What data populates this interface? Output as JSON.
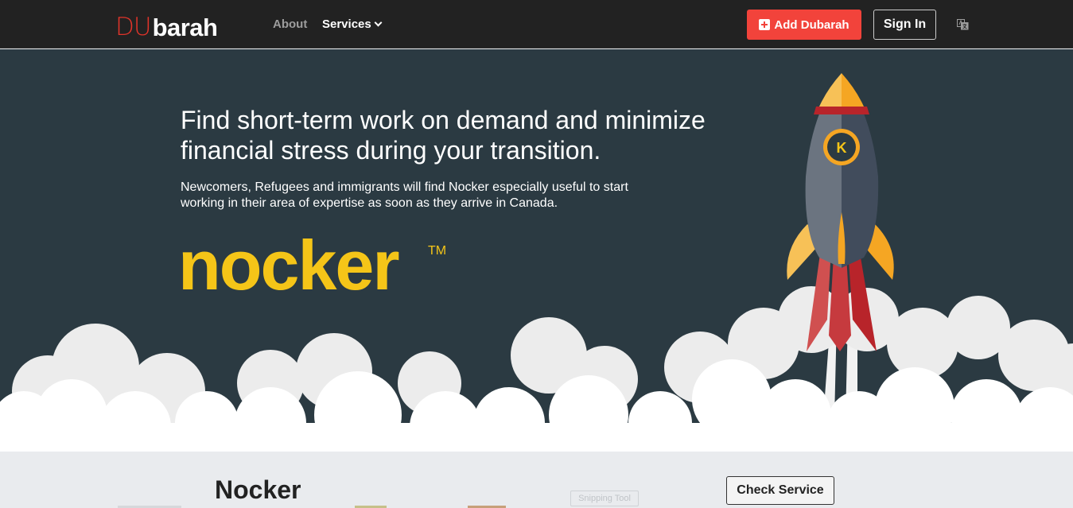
{
  "nav": {
    "logo_du": "DU",
    "logo_barah": "barah",
    "about_label": "About",
    "services_label": "Services",
    "add_label": "Add Dubarah",
    "signin_label": "Sign In"
  },
  "hero": {
    "title": "Find short-term work on demand and minimize financial stress during your transition.",
    "subtitle": "Newcomers, Refugees and immigrants will find Nocker especially useful to start working in their area of expertise as soon as they arrive in Canada.",
    "logo_text": "nocker",
    "logo_tm": "TM",
    "rocket_badge": "K"
  },
  "service": {
    "title": "Nocker",
    "check_label": "Check Service",
    "snip_label": "Snipping Tool"
  },
  "colors": {
    "navbar_bg": "#222222",
    "accent_red": "#f2433b",
    "hero_bg": "#2b3a42",
    "nocker_yellow": "#f5c518"
  },
  "icons": {
    "add": "plus-square-icon",
    "services_dropdown": "chevron-down-icon",
    "language": "language-icon"
  }
}
